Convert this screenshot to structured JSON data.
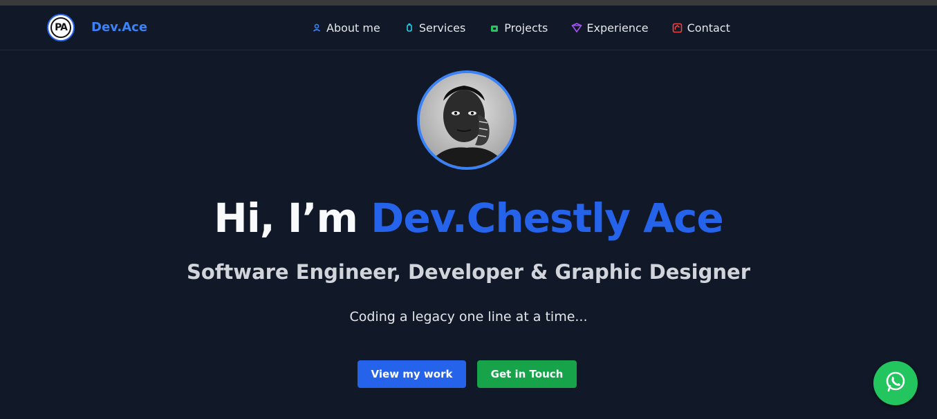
{
  "brand": {
    "logo_text": "PA",
    "name": "Dev.Ace"
  },
  "nav": [
    {
      "label": "About me",
      "icon": "user-icon",
      "color": "#3b82f6"
    },
    {
      "label": "Services",
      "icon": "bottle-icon",
      "color": "#22d3ee"
    },
    {
      "label": "Projects",
      "icon": "box-icon",
      "color": "#22c55e"
    },
    {
      "label": "Experience",
      "icon": "diamond-icon",
      "color": "#a855f7"
    },
    {
      "label": "Contact",
      "icon": "contact-icon",
      "color": "#ef4444"
    }
  ],
  "hero": {
    "greeting": "Hi, I’m ",
    "name": "Dev.Chestly Ace",
    "subtitle": "Software Engineer, Developer & Graphic Designer",
    "tagline": "Coding a legacy one line at a time..."
  },
  "buttons": {
    "primary": "View my work",
    "secondary": "Get in Touch"
  },
  "colors": {
    "background": "#111827",
    "accent": "#2563eb",
    "success": "#16a34a",
    "whatsapp": "#22c55e"
  },
  "floating": {
    "icon": "whatsapp-icon"
  }
}
